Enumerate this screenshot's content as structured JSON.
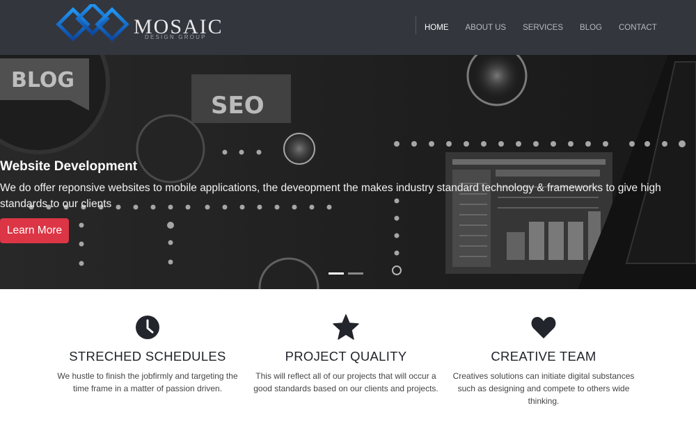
{
  "brand": {
    "name": "MOSAIC",
    "tagline": "DESIGN GROUP",
    "logo_colors": [
      "#1e88e5",
      "#0d47a1"
    ]
  },
  "nav": {
    "items": [
      {
        "label": "HOME",
        "active": true
      },
      {
        "label": "ABOUT US",
        "active": false
      },
      {
        "label": "SERVICES",
        "active": false
      },
      {
        "label": "BLOG",
        "active": false
      },
      {
        "label": "CONTACT",
        "active": false
      }
    ]
  },
  "hero": {
    "title": "Website Development",
    "text": "We do offer reponsive websites to mobile applications, the deveopment the makes industry standard technology & frameworks to give high standards to our clients",
    "button_label": "Learn More",
    "button_color": "#dc3545",
    "slide_count": 2,
    "active_slide": 1,
    "bg_signs": [
      "BLOG",
      "SEO"
    ]
  },
  "features": [
    {
      "icon": "clock-icon",
      "title": "STRECHED SCHEDULES",
      "text": "We hustle to finish the jobfirmly and targeting the time frame in a matter of passion driven."
    },
    {
      "icon": "star-icon",
      "title": "PROJECT QUALITY",
      "text": "This will reflect all of our projects that will occur a good standards based on our clients and projects."
    },
    {
      "icon": "heart-icon",
      "title": "CREATIVE TEAM",
      "text": "Creatives solutions can initiate digital substances such as designing and compete to others wide thinking."
    }
  ]
}
